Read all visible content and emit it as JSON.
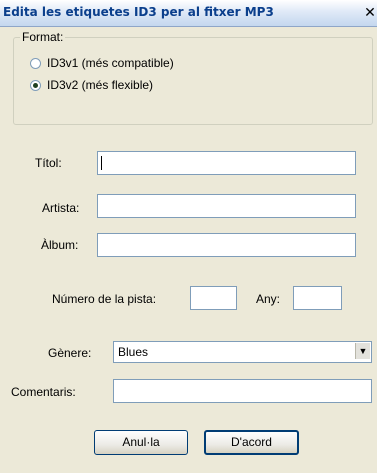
{
  "window": {
    "title": "Edita les etiquetes ID3 per al fitxer MP3",
    "close_glyph": "✕"
  },
  "format": {
    "legend": "Format:",
    "options": [
      {
        "label": "ID3v1 (més compatible)",
        "selected": false
      },
      {
        "label": "ID3v2 (més flexible)",
        "selected": true
      }
    ]
  },
  "fields": {
    "title_label": "Títol:",
    "title_value": "",
    "artist_label": "Artista:",
    "artist_value": "",
    "album_label": "Àlbum:",
    "album_value": "",
    "track_label": "Número de la pista:",
    "track_value": "",
    "year_label": "Any:",
    "year_value": "",
    "genre_label": "Gènere:",
    "genre_value": "Blues",
    "comments_label": "Comentaris:",
    "comments_value": ""
  },
  "buttons": {
    "cancel": "Anul·la",
    "ok": "D'acord"
  }
}
